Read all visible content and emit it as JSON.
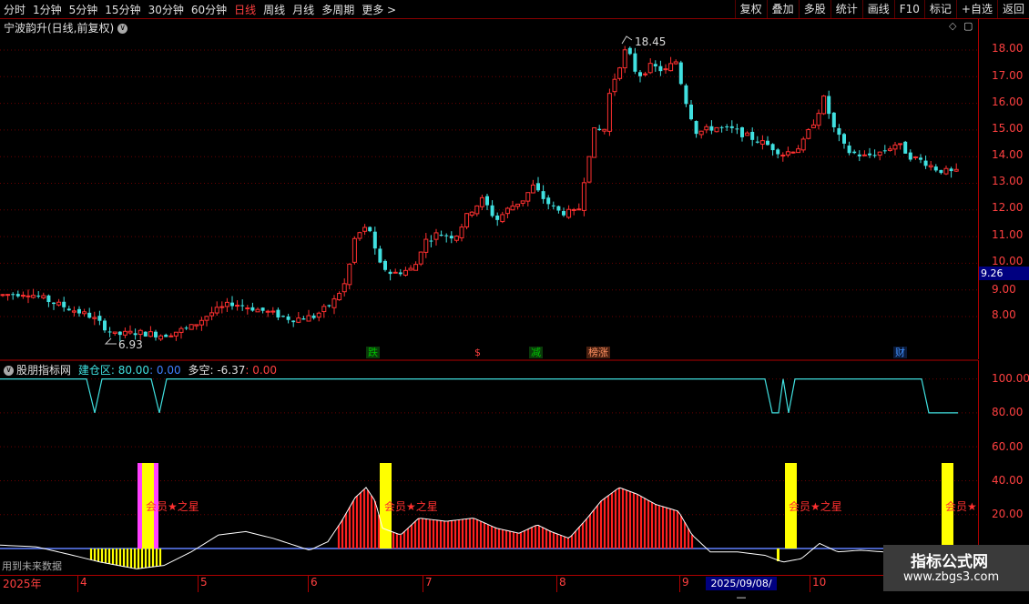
{
  "toolbar": {
    "periods": [
      "分时",
      "1分钟",
      "5分钟",
      "15分钟",
      "30分钟",
      "60分钟",
      "日线",
      "周线",
      "月线",
      "多周期",
      "更多 >"
    ],
    "active_period": "日线",
    "actions": [
      "复权",
      "叠加",
      "多股",
      "统计",
      "画线",
      "F10",
      "标记",
      "+自选",
      "返回"
    ]
  },
  "stock": {
    "title": "宁波韵升(日线,前复权)",
    "dropdown_glyph": "∨",
    "current_price": "9.26"
  },
  "price_axis": {
    "ticks": [
      "18.00",
      "17.00",
      "16.00",
      "15.00",
      "14.00",
      "13.00",
      "12.00",
      "11.00",
      "10.00",
      "9.00",
      "8.00"
    ],
    "high_label": "18.45",
    "low_label": "6.93"
  },
  "events": [
    {
      "label": "跌",
      "color": "#00c000"
    },
    {
      "label": "$",
      "color": "#ff4040"
    },
    {
      "label": "减",
      "color": "#00c000"
    },
    {
      "label": "榜涨",
      "color": "#ff8040"
    },
    {
      "label": "财",
      "color": "#4090ff"
    }
  ],
  "indicator": {
    "name": "股朋指标网",
    "field1_label": "建仓区: 80.00",
    "field1_value": ": 0.00",
    "field2_label": "多空: -6.37",
    "field2_value": ": 0.00",
    "collapse_glyph": "∨",
    "ticks": [
      "100.00",
      "80.00",
      "60.00",
      "40.00",
      "20.00"
    ],
    "star_label": "会员★之星",
    "star_label_cut": "会员★",
    "future_note": "用到未来数据"
  },
  "dates": {
    "year": "2025年",
    "months": [
      "4",
      "5",
      "6",
      "7",
      "8",
      "9",
      "10"
    ],
    "highlight": "2025/09/08/—"
  },
  "watermark": {
    "title": "指标公式网",
    "url": "www.zbgs3.com"
  },
  "colors": {
    "up": "#ff3030",
    "down": "#40e0e0",
    "axis": "#b00000",
    "yellow": "#ffff00",
    "magenta": "#ff40ff"
  }
}
